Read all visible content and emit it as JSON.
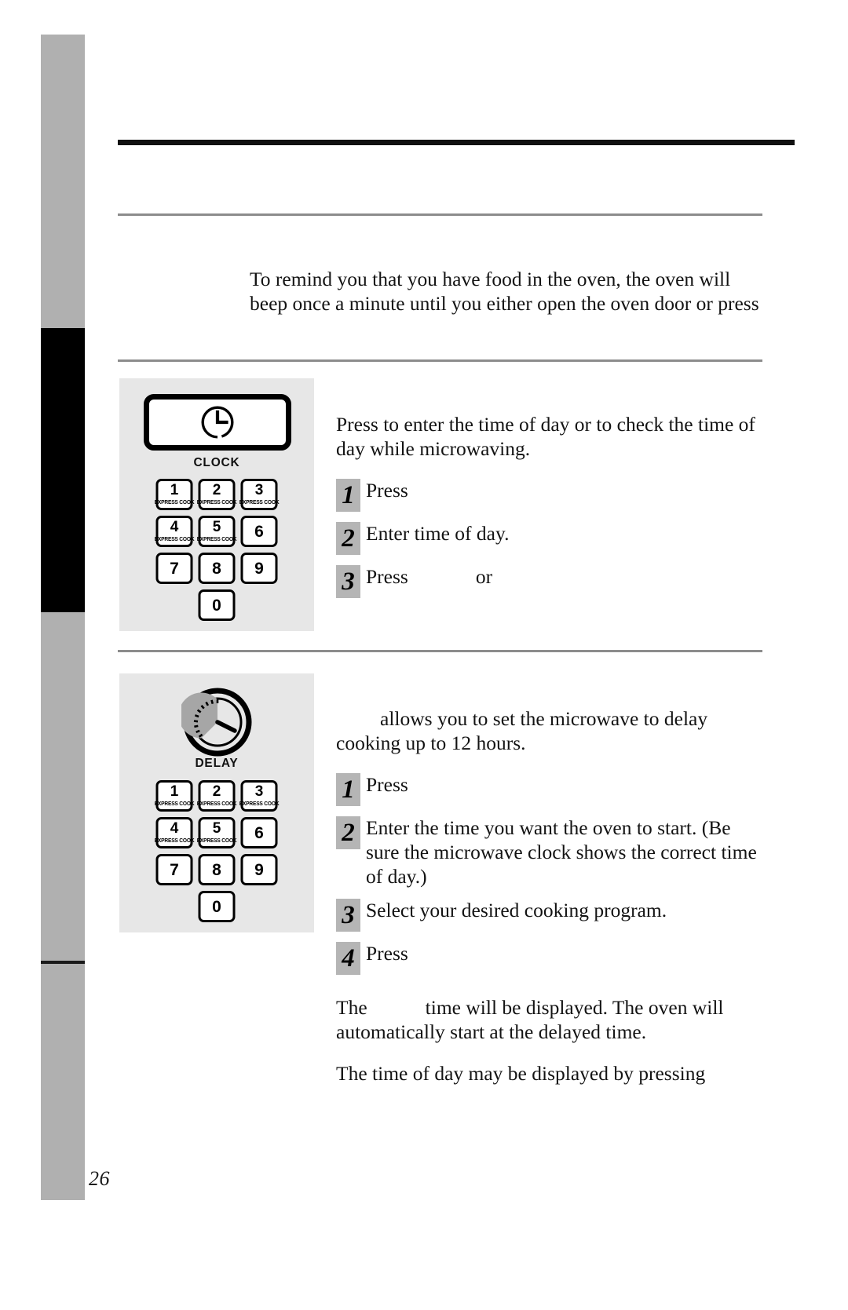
{
  "page": {
    "number": "26"
  },
  "intro": {
    "text": "To remind you that you have food in the oven, the oven will beep once a minute until you either open the oven door or press"
  },
  "sections": [
    {
      "id": "clock",
      "panel": {
        "button_caption": "CLOCK",
        "button_icon": "clock-icon",
        "keypad": [
          [
            {
              "digit": "1",
              "sub": "EXPRESS COOK"
            },
            {
              "digit": "2",
              "sub": "EXPRESS COOK"
            },
            {
              "digit": "3",
              "sub": "EXPRESS COOK"
            }
          ],
          [
            {
              "digit": "4",
              "sub": "EXPRESS COOK"
            },
            {
              "digit": "5",
              "sub": "EXPRESS COOK"
            },
            {
              "digit": "6",
              "sub": ""
            }
          ],
          [
            {
              "digit": "7",
              "sub": ""
            },
            {
              "digit": "8",
              "sub": ""
            },
            {
              "digit": "9",
              "sub": ""
            }
          ],
          [
            {
              "digit": "0",
              "sub": ""
            }
          ]
        ]
      },
      "lead": "Press to enter the time of day or to check the time of day while microwaving.",
      "steps": [
        {
          "num": "1",
          "pre": "Press",
          "mid": "",
          "post": ""
        },
        {
          "num": "2",
          "pre": "Enter time of day.",
          "mid": "",
          "post": ""
        },
        {
          "num": "3",
          "pre": "Press",
          "mid": "or",
          "post": ""
        }
      ]
    },
    {
      "id": "delay",
      "panel": {
        "button_caption": "DELAY",
        "button_icon": "delay-timer-dial-icon",
        "keypad": [
          [
            {
              "digit": "1",
              "sub": "EXPRESS COOK"
            },
            {
              "digit": "2",
              "sub": "EXPRESS COOK"
            },
            {
              "digit": "3",
              "sub": "EXPRESS COOK"
            }
          ],
          [
            {
              "digit": "4",
              "sub": "EXPRESS COOK"
            },
            {
              "digit": "5",
              "sub": "EXPRESS COOK"
            },
            {
              "digit": "6",
              "sub": ""
            }
          ],
          [
            {
              "digit": "7",
              "sub": ""
            },
            {
              "digit": "8",
              "sub": ""
            },
            {
              "digit": "9",
              "sub": ""
            }
          ],
          [
            {
              "digit": "0",
              "sub": ""
            }
          ]
        ]
      },
      "lead": "allows you to set the microwave to delay cooking up to 12 hours.",
      "steps": [
        {
          "num": "1",
          "pre": "Press",
          "mid": "",
          "post": ""
        },
        {
          "num": "2",
          "pre": "Enter the time you want the oven to start. (Be sure the microwave clock shows the correct time of day.)",
          "mid": "",
          "post": ""
        },
        {
          "num": "3",
          "pre": "Select your desired cooking program.",
          "mid": "",
          "post": ""
        },
        {
          "num": "4",
          "pre": "Press",
          "mid": "",
          "post": ""
        }
      ],
      "tail": [
        {
          "pre": "The",
          "post": "time will be displayed. The oven will automatically start at the delayed time."
        },
        {
          "pre": "The time of day may be displayed by pressing",
          "post": ""
        }
      ]
    }
  ]
}
